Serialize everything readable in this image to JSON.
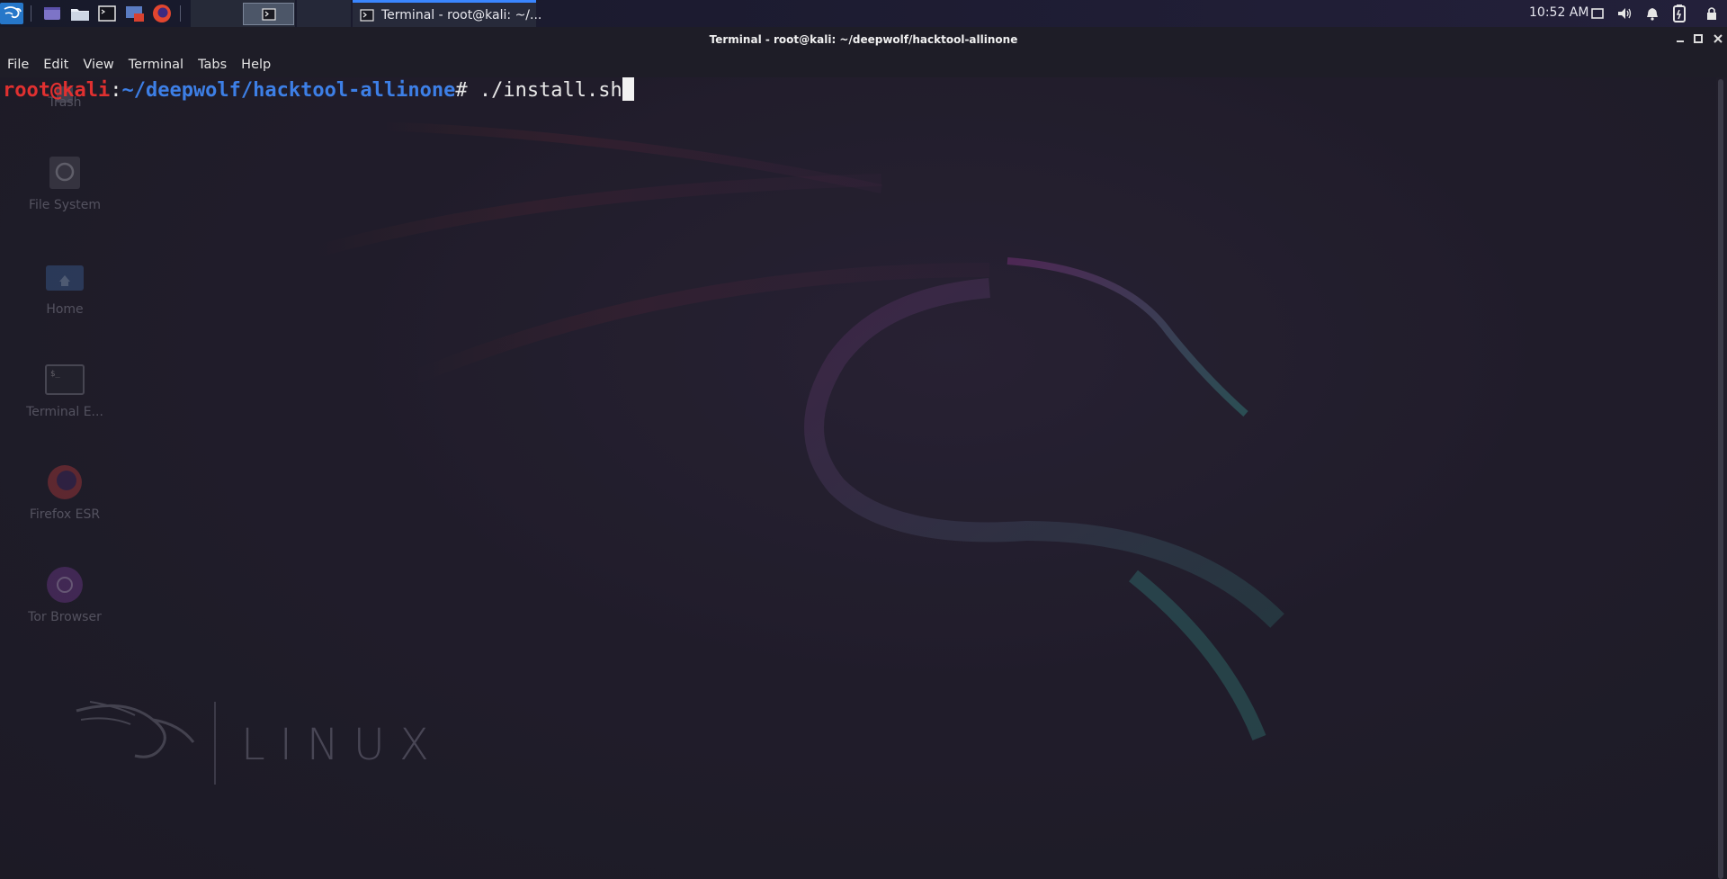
{
  "panel": {
    "clock": "10:52 AM",
    "task_title": "Terminal - root@kali: ~/...",
    "apps": [
      "kali-menu-icon",
      "window-icon",
      "folder-icon",
      "terminal-icon",
      "browser-icon",
      "firefox-icon"
    ],
    "tray": [
      "screen-icon",
      "volume-icon",
      "bell-icon",
      "battery-icon",
      "lock-icon"
    ]
  },
  "window": {
    "title": "Terminal - root@kali: ~/deepwolf/hacktool-allinone"
  },
  "menubar": {
    "items": [
      "File",
      "Edit",
      "View",
      "Terminal",
      "Tabs",
      "Help"
    ]
  },
  "terminal": {
    "user_host": "root@kali",
    "colon": ":",
    "path": "~/deepwolf/hacktool-allinone",
    "hash": "#",
    "command": " ./install.sh"
  },
  "desktop": {
    "icons": [
      {
        "label": "Trash",
        "icon": "trash-icon"
      },
      {
        "label": "File System",
        "icon": "drive-icon"
      },
      {
        "label": "Home",
        "icon": "home-folder-icon"
      },
      {
        "label": "Terminal E...",
        "icon": "terminal-icon"
      },
      {
        "label": "Firefox ESR",
        "icon": "firefox-icon"
      },
      {
        "label": "Tor Browser",
        "icon": "tor-icon"
      }
    ],
    "logo_text": "LINUX"
  },
  "colors": {
    "accent": "#3a86ff",
    "prompt_user": "#e03030",
    "prompt_path": "#3d7fe6"
  }
}
